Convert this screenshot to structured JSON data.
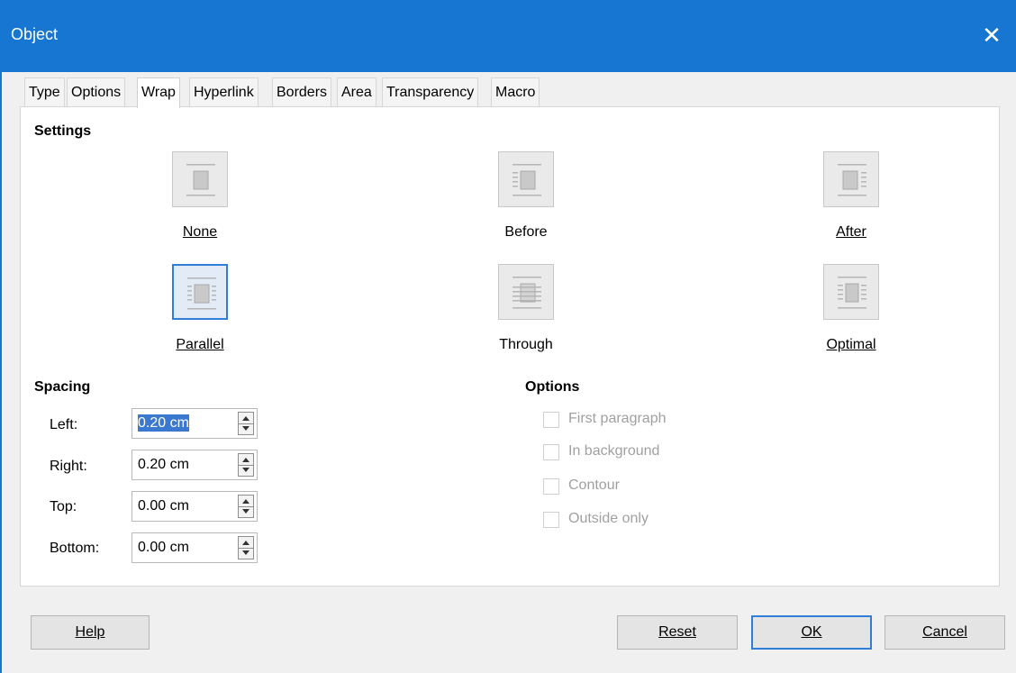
{
  "window": {
    "title": "Object",
    "close_glyph": "✕"
  },
  "tabs": [
    "Type",
    "Options",
    "Wrap",
    "Hyperlink",
    "Borders",
    "Area",
    "Transparency",
    "Macro"
  ],
  "active_tab": "Wrap",
  "settings": {
    "title": "Settings",
    "options": [
      {
        "label": "None",
        "icon": "wrap-none-icon",
        "selected": false
      },
      {
        "label": "Before",
        "icon": "wrap-before-icon",
        "selected": false
      },
      {
        "label": "After",
        "icon": "wrap-after-icon",
        "selected": false
      },
      {
        "label": "Parallel",
        "icon": "wrap-parallel-icon",
        "selected": true
      },
      {
        "label": "Through",
        "icon": "wrap-through-icon",
        "selected": false
      },
      {
        "label": "Optimal",
        "icon": "wrap-optimal-icon",
        "selected": false
      }
    ]
  },
  "spacing": {
    "title": "Spacing",
    "fields": [
      {
        "label": "Left:",
        "value": "0.20 cm"
      },
      {
        "label": "Right:",
        "value": "0.20 cm"
      },
      {
        "label": "Top:",
        "value": "0.00 cm"
      },
      {
        "label": "Bottom:",
        "value": "0.00 cm"
      }
    ]
  },
  "options": {
    "title": "Options",
    "checkboxes": [
      {
        "label": "First paragraph",
        "checked": false,
        "enabled": false
      },
      {
        "label": "In background",
        "checked": false,
        "enabled": false
      },
      {
        "label": "Contour",
        "checked": false,
        "enabled": false
      },
      {
        "label": "Outside only",
        "checked": false,
        "enabled": false
      }
    ]
  },
  "buttons": {
    "help": "Help",
    "reset": "Reset",
    "ok": "OK",
    "cancel": "Cancel"
  },
  "colors": {
    "titlebar": "#1676d2",
    "accent": "#2f7fd8"
  }
}
